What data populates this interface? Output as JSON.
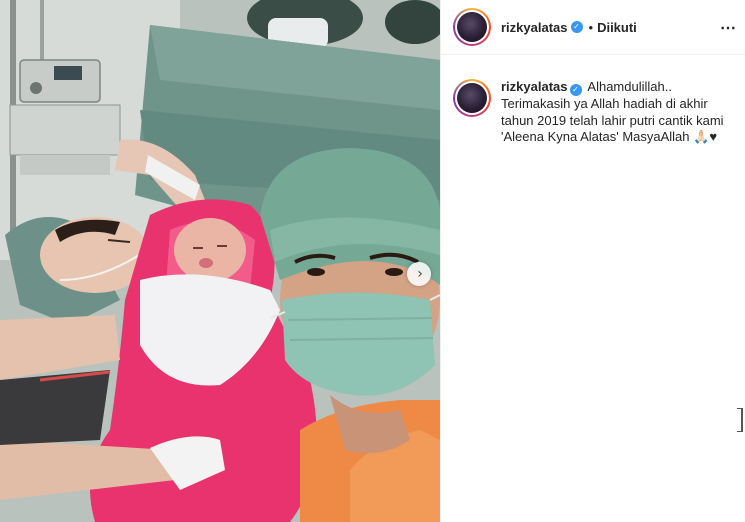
{
  "post": {
    "username": "rizkyalatas",
    "follow_status": "Diikuti",
    "separator": "•",
    "more_icon": "⋯",
    "verified_icon": "✓",
    "next_icon": "›",
    "caption": {
      "username": "rizkyalatas",
      "text": "Alhamdulillah.. Terimakasih ya Allah hadiah di akhir tahun 2019 telah lahir putri cantik kami 'Aleena Kyna Alatas' MasyaAllah 🙏🏻♥"
    }
  },
  "icons": {
    "verified": "verified-badge-icon",
    "more": "more-options-icon",
    "next": "chevron-right-icon"
  },
  "colors": {
    "verified_blue": "#3897f0",
    "text": "#262626",
    "border": "#efefef",
    "scrub_green": "#76a896",
    "blanket_pink": "#e8336f",
    "scrub_orange": "#ef8a46"
  }
}
